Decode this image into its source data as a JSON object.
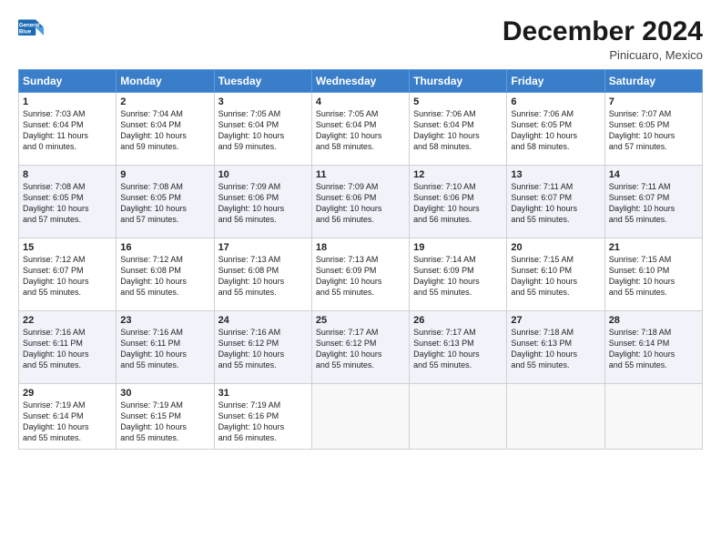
{
  "header": {
    "logo_line1": "General",
    "logo_line2": "Blue",
    "title": "December 2024",
    "subtitle": "Pinicuaro, Mexico"
  },
  "days_of_week": [
    "Sunday",
    "Monday",
    "Tuesday",
    "Wednesday",
    "Thursday",
    "Friday",
    "Saturday"
  ],
  "weeks": [
    [
      {
        "day": "1",
        "info": "Sunrise: 7:03 AM\nSunset: 6:04 PM\nDaylight: 11 hours\nand 0 minutes."
      },
      {
        "day": "2",
        "info": "Sunrise: 7:04 AM\nSunset: 6:04 PM\nDaylight: 10 hours\nand 59 minutes."
      },
      {
        "day": "3",
        "info": "Sunrise: 7:05 AM\nSunset: 6:04 PM\nDaylight: 10 hours\nand 59 minutes."
      },
      {
        "day": "4",
        "info": "Sunrise: 7:05 AM\nSunset: 6:04 PM\nDaylight: 10 hours\nand 58 minutes."
      },
      {
        "day": "5",
        "info": "Sunrise: 7:06 AM\nSunset: 6:04 PM\nDaylight: 10 hours\nand 58 minutes."
      },
      {
        "day": "6",
        "info": "Sunrise: 7:06 AM\nSunset: 6:05 PM\nDaylight: 10 hours\nand 58 minutes."
      },
      {
        "day": "7",
        "info": "Sunrise: 7:07 AM\nSunset: 6:05 PM\nDaylight: 10 hours\nand 57 minutes."
      }
    ],
    [
      {
        "day": "8",
        "info": "Sunrise: 7:08 AM\nSunset: 6:05 PM\nDaylight: 10 hours\nand 57 minutes."
      },
      {
        "day": "9",
        "info": "Sunrise: 7:08 AM\nSunset: 6:05 PM\nDaylight: 10 hours\nand 57 minutes."
      },
      {
        "day": "10",
        "info": "Sunrise: 7:09 AM\nSunset: 6:06 PM\nDaylight: 10 hours\nand 56 minutes."
      },
      {
        "day": "11",
        "info": "Sunrise: 7:09 AM\nSunset: 6:06 PM\nDaylight: 10 hours\nand 56 minutes."
      },
      {
        "day": "12",
        "info": "Sunrise: 7:10 AM\nSunset: 6:06 PM\nDaylight: 10 hours\nand 56 minutes."
      },
      {
        "day": "13",
        "info": "Sunrise: 7:11 AM\nSunset: 6:07 PM\nDaylight: 10 hours\nand 55 minutes."
      },
      {
        "day": "14",
        "info": "Sunrise: 7:11 AM\nSunset: 6:07 PM\nDaylight: 10 hours\nand 55 minutes."
      }
    ],
    [
      {
        "day": "15",
        "info": "Sunrise: 7:12 AM\nSunset: 6:07 PM\nDaylight: 10 hours\nand 55 minutes."
      },
      {
        "day": "16",
        "info": "Sunrise: 7:12 AM\nSunset: 6:08 PM\nDaylight: 10 hours\nand 55 minutes."
      },
      {
        "day": "17",
        "info": "Sunrise: 7:13 AM\nSunset: 6:08 PM\nDaylight: 10 hours\nand 55 minutes."
      },
      {
        "day": "18",
        "info": "Sunrise: 7:13 AM\nSunset: 6:09 PM\nDaylight: 10 hours\nand 55 minutes."
      },
      {
        "day": "19",
        "info": "Sunrise: 7:14 AM\nSunset: 6:09 PM\nDaylight: 10 hours\nand 55 minutes."
      },
      {
        "day": "20",
        "info": "Sunrise: 7:15 AM\nSunset: 6:10 PM\nDaylight: 10 hours\nand 55 minutes."
      },
      {
        "day": "21",
        "info": "Sunrise: 7:15 AM\nSunset: 6:10 PM\nDaylight: 10 hours\nand 55 minutes."
      }
    ],
    [
      {
        "day": "22",
        "info": "Sunrise: 7:16 AM\nSunset: 6:11 PM\nDaylight: 10 hours\nand 55 minutes."
      },
      {
        "day": "23",
        "info": "Sunrise: 7:16 AM\nSunset: 6:11 PM\nDaylight: 10 hours\nand 55 minutes."
      },
      {
        "day": "24",
        "info": "Sunrise: 7:16 AM\nSunset: 6:12 PM\nDaylight: 10 hours\nand 55 minutes."
      },
      {
        "day": "25",
        "info": "Sunrise: 7:17 AM\nSunset: 6:12 PM\nDaylight: 10 hours\nand 55 minutes."
      },
      {
        "day": "26",
        "info": "Sunrise: 7:17 AM\nSunset: 6:13 PM\nDaylight: 10 hours\nand 55 minutes."
      },
      {
        "day": "27",
        "info": "Sunrise: 7:18 AM\nSunset: 6:13 PM\nDaylight: 10 hours\nand 55 minutes."
      },
      {
        "day": "28",
        "info": "Sunrise: 7:18 AM\nSunset: 6:14 PM\nDaylight: 10 hours\nand 55 minutes."
      }
    ],
    [
      {
        "day": "29",
        "info": "Sunrise: 7:19 AM\nSunset: 6:14 PM\nDaylight: 10 hours\nand 55 minutes."
      },
      {
        "day": "30",
        "info": "Sunrise: 7:19 AM\nSunset: 6:15 PM\nDaylight: 10 hours\nand 55 minutes."
      },
      {
        "day": "31",
        "info": "Sunrise: 7:19 AM\nSunset: 6:16 PM\nDaylight: 10 hours\nand 56 minutes."
      },
      {
        "day": "",
        "info": ""
      },
      {
        "day": "",
        "info": ""
      },
      {
        "day": "",
        "info": ""
      },
      {
        "day": "",
        "info": ""
      }
    ]
  ]
}
